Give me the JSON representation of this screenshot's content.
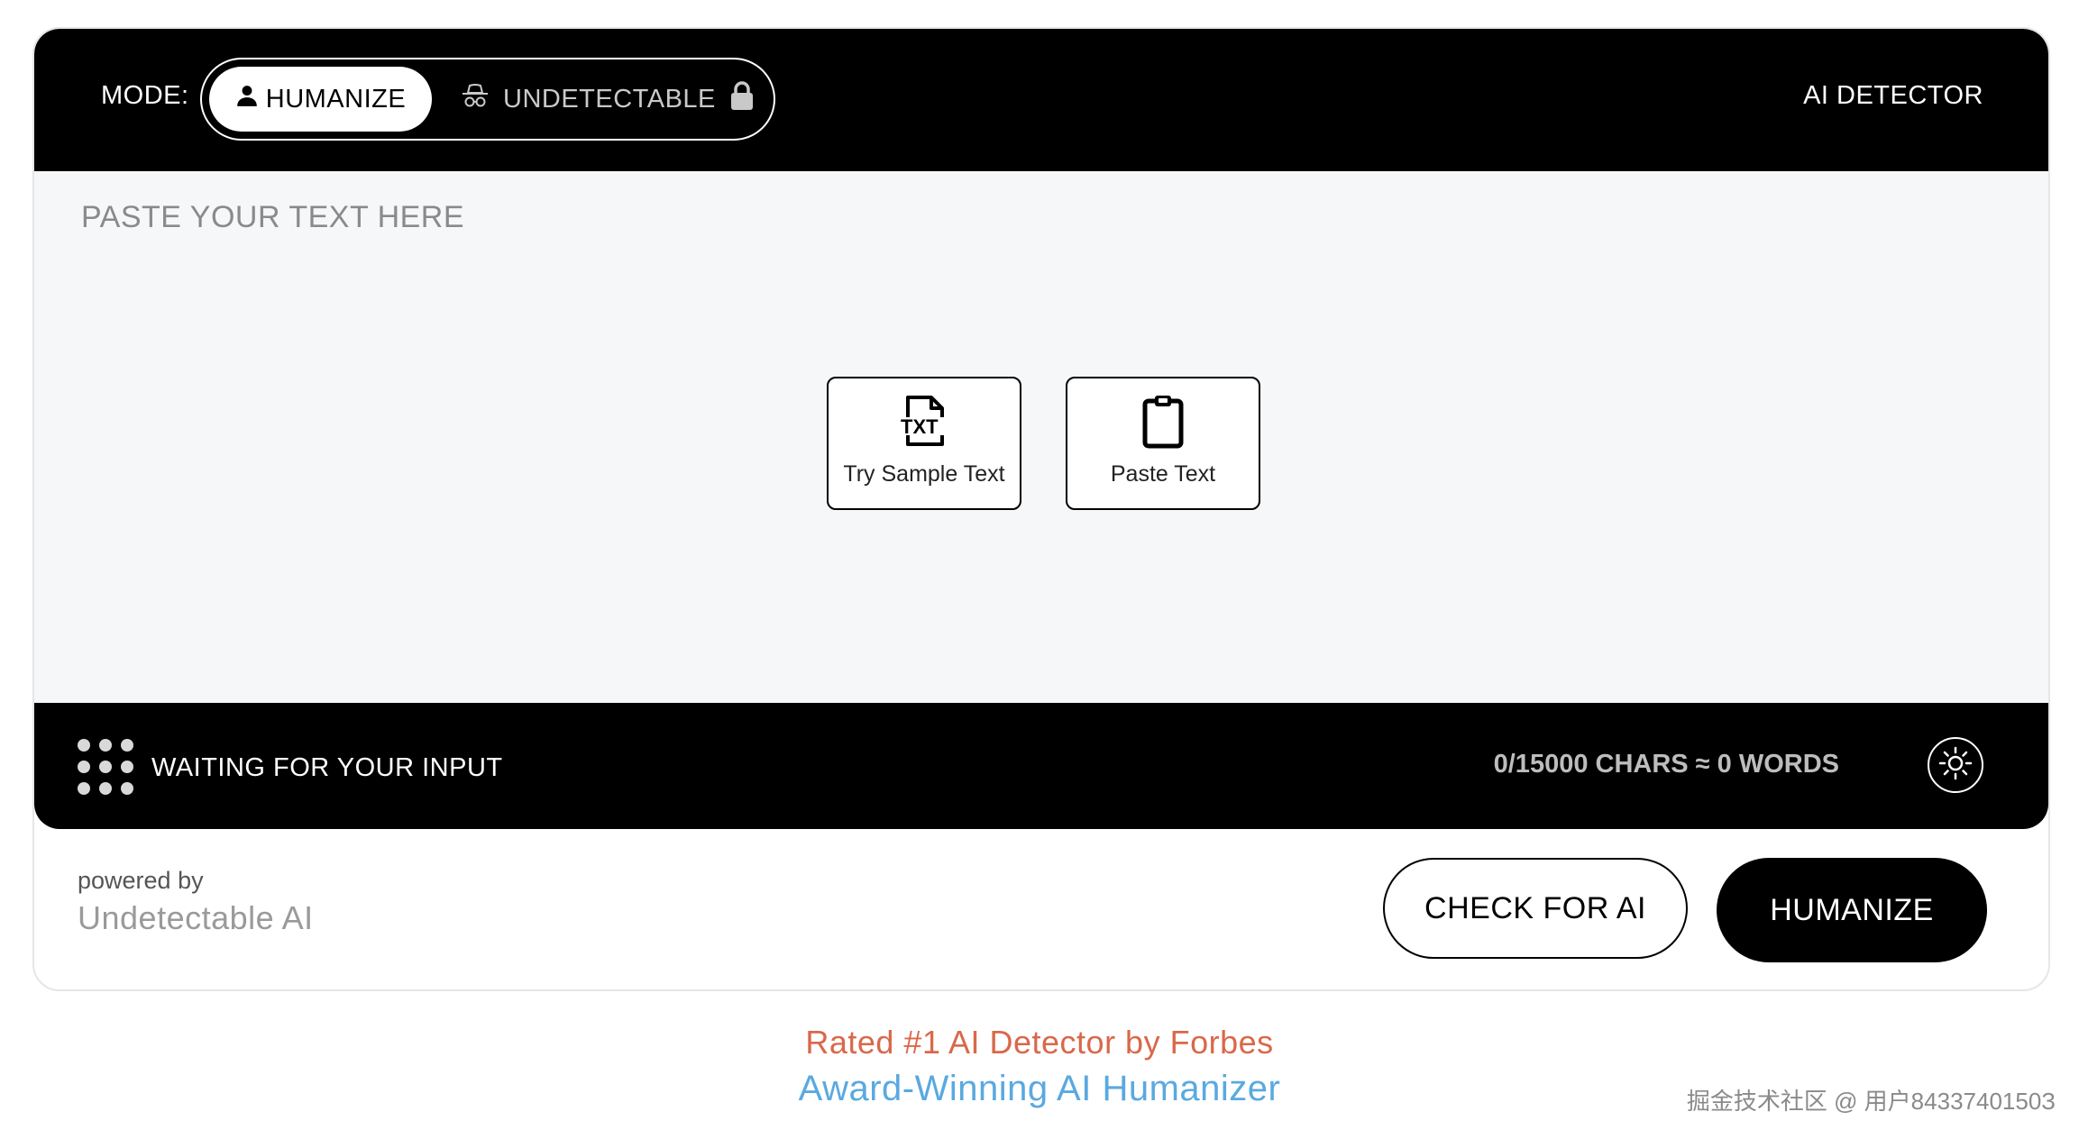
{
  "header": {
    "mode_label": "MODE:",
    "modes": [
      {
        "label": "HUMANIZE",
        "icon": "person-icon",
        "selected": true
      },
      {
        "label": "UNDETECTABLE",
        "icon": "spy-icon",
        "locked": true
      }
    ],
    "ai_detector_label": "AI DETECTOR"
  },
  "editor": {
    "placeholder": "PASTE YOUR TEXT HERE",
    "actions": [
      {
        "label": "Try Sample Text",
        "icon": "txt-file-icon"
      },
      {
        "label": "Paste Text",
        "icon": "clipboard-icon"
      }
    ]
  },
  "status": {
    "text": "WAITING FOR YOUR INPUT",
    "char_count": "0/15000 CHARS ≈ 0 WORDS",
    "loader_icon": "dots-grid-icon",
    "theme_icon": "sun-icon"
  },
  "footer": {
    "powered_by": "powered by",
    "brand": "Undetectable AI",
    "check_button": "CHECK FOR AI",
    "humanize_button": "HUMANIZE"
  },
  "taglines": {
    "line1": "Rated #1 AI Detector by Forbes",
    "line2": "Award-Winning AI Humanizer"
  },
  "watermark": "掘金技术社区 @ 用户8433740150З",
  "colors": {
    "accent_black": "#000000",
    "editor_bg": "#f6f7f9",
    "tagline_orange": "#d9684a",
    "tagline_blue": "#5aa9e0"
  }
}
